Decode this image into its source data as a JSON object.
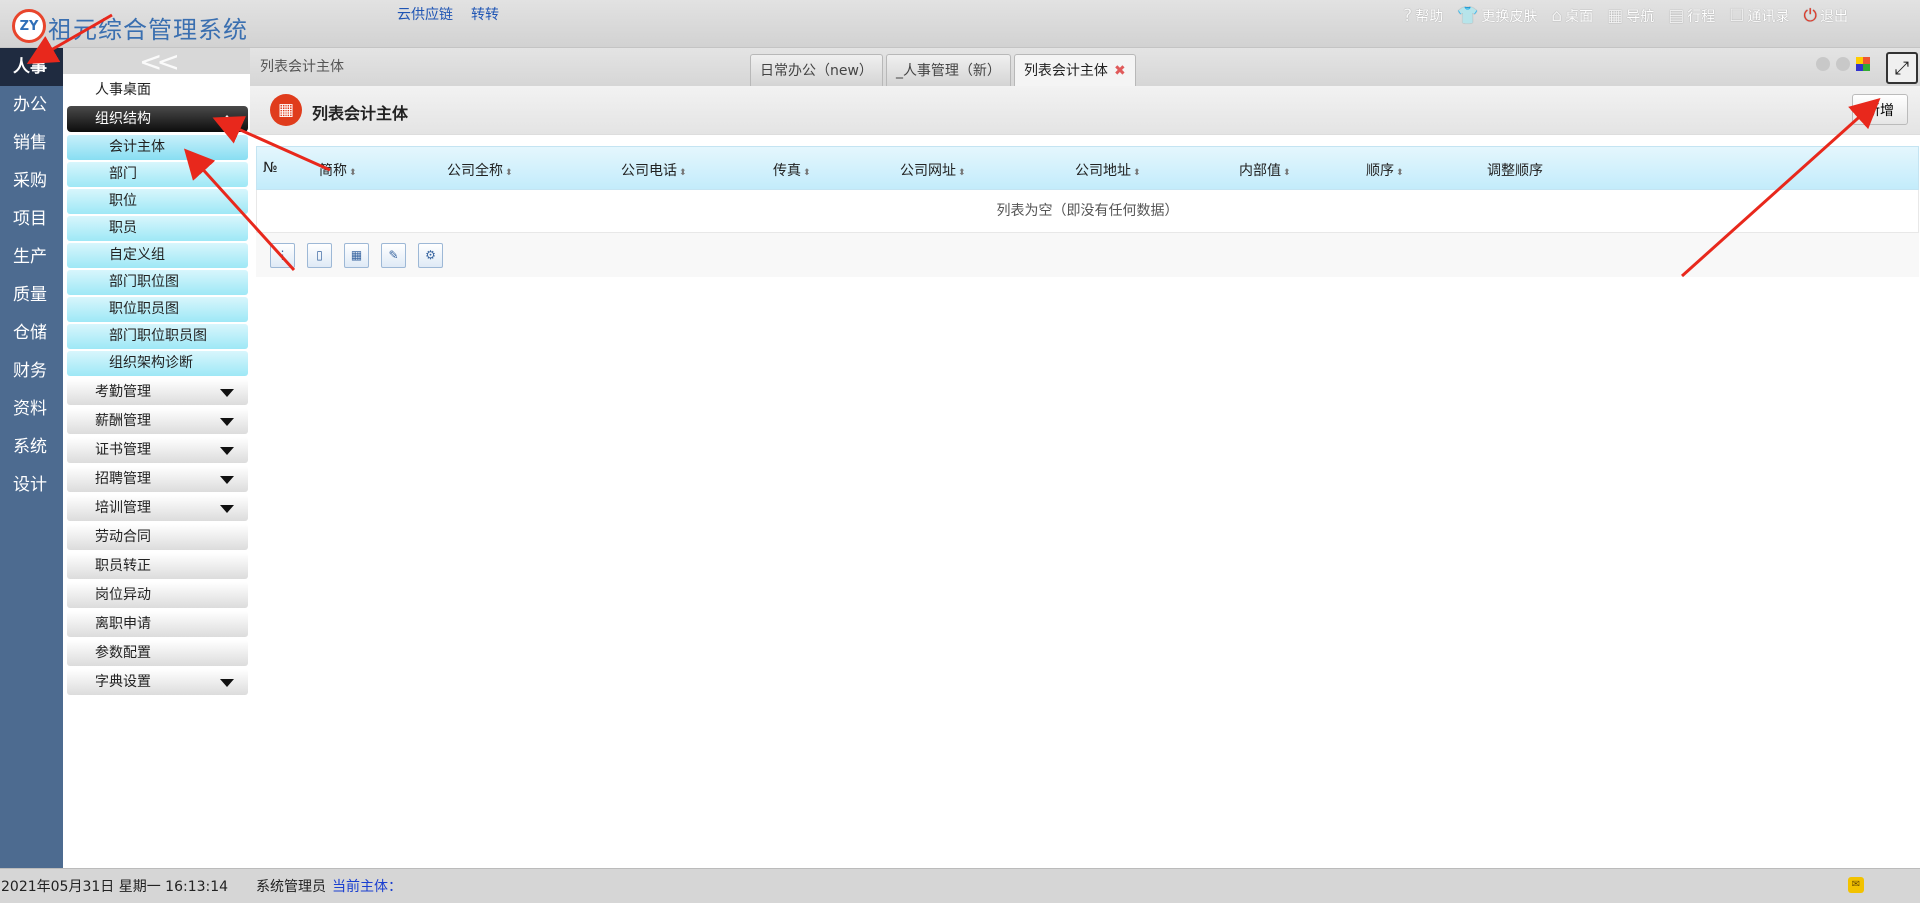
{
  "header": {
    "logo_text": "ZY",
    "app_title": "祖元综合管理系统",
    "links": [
      "云供应链",
      "转转"
    ],
    "actions": [
      {
        "icon": "help-icon",
        "glyph": "?",
        "label": "帮助"
      },
      {
        "icon": "shirt-icon",
        "glyph": "👕",
        "label": "更换皮肤"
      },
      {
        "icon": "home-icon",
        "glyph": "⌂",
        "label": "桌面"
      },
      {
        "icon": "grid-icon",
        "glyph": "▦",
        "label": "导航"
      },
      {
        "icon": "calendar-icon",
        "glyph": "▤",
        "label": "行程"
      },
      {
        "icon": "contacts-icon",
        "glyph": "☐",
        "label": "通讯录"
      },
      {
        "icon": "power-icon",
        "glyph": "⏻",
        "label": "退出"
      }
    ]
  },
  "mainnav": [
    "人事",
    "办公",
    "销售",
    "采购",
    "项目",
    "生产",
    "质量",
    "仓储",
    "财务",
    "资料",
    "系统",
    "设计"
  ],
  "subnav": {
    "collapse_glyph": "<<",
    "items": [
      {
        "label": "人事桌面",
        "kind": "plain"
      },
      {
        "label": "组织结构",
        "kind": "open"
      },
      {
        "label": "会计主体",
        "kind": "sub-active"
      },
      {
        "label": "部门",
        "kind": "sub"
      },
      {
        "label": "职位",
        "kind": "sub"
      },
      {
        "label": "职员",
        "kind": "sub"
      },
      {
        "label": "自定义组",
        "kind": "sub"
      },
      {
        "label": "部门职位图",
        "kind": "sub"
      },
      {
        "label": "职位职员图",
        "kind": "sub"
      },
      {
        "label": "部门职位职员图",
        "kind": "sub"
      },
      {
        "label": "组织架构诊断",
        "kind": "sub"
      },
      {
        "label": "考勤管理",
        "kind": "group-arrow"
      },
      {
        "label": "薪酬管理",
        "kind": "group-arrow"
      },
      {
        "label": "证书管理",
        "kind": "group-arrow"
      },
      {
        "label": "招聘管理",
        "kind": "group-arrow"
      },
      {
        "label": "培训管理",
        "kind": "group-arrow"
      },
      {
        "label": "劳动合同",
        "kind": "group"
      },
      {
        "label": "职员转正",
        "kind": "group"
      },
      {
        "label": "岗位异动",
        "kind": "group"
      },
      {
        "label": "离职申请",
        "kind": "group"
      },
      {
        "label": "参数配置",
        "kind": "group"
      },
      {
        "label": "字典设置",
        "kind": "group-arrow"
      }
    ]
  },
  "content": {
    "breadcrumb": "列表会计主体",
    "tabs": [
      {
        "label": "日常办公（new）",
        "active": false
      },
      {
        "label": "_人事管理（新）",
        "active": false
      },
      {
        "label": "列表会计主体",
        "active": true,
        "closable": true
      }
    ],
    "tab_close_glyph": "✖",
    "fullscreen_glyph": "⤢",
    "page_title": "列表会计主体",
    "page_icon_glyph": "▦",
    "add_button": "新增",
    "columns": [
      "№",
      "简称",
      "公司全称",
      "公司电话",
      "传真",
      "公司网址",
      "公司地址",
      "内部值",
      "顺序",
      "调整顺序"
    ],
    "empty_text": "列表为空（即没有任何数据）",
    "toolbar": [
      {
        "icon": "select-icon",
        "glyph": "⋮"
      },
      {
        "icon": "document-icon",
        "glyph": "▯"
      },
      {
        "icon": "table-icon",
        "glyph": "▦"
      },
      {
        "icon": "edit-icon",
        "glyph": "✎"
      },
      {
        "icon": "settings-icon",
        "glyph": "⚙"
      }
    ]
  },
  "status": {
    "datetime": "2021年05月31日 星期一 16:13:14",
    "user": "系统管理员",
    "current_entity_label": "当前主体：",
    "message_icon_glyph": "✉"
  },
  "colors": {
    "mainnav_bg": "#4d6b90",
    "mainnav_active_bg": "#1f2b40",
    "sub_item_bg": "#a8eaf7",
    "annotation_arrow": "#e8281c"
  }
}
